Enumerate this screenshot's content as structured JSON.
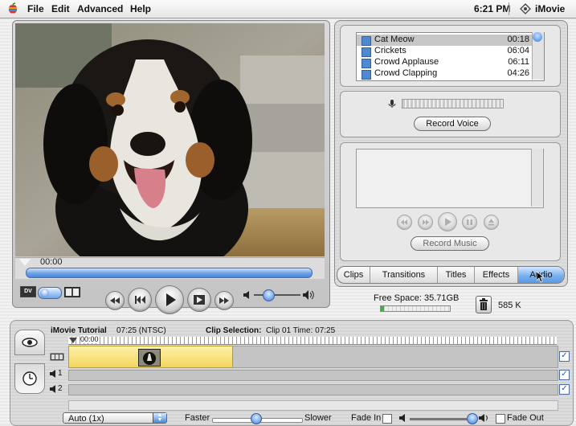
{
  "menubar": {
    "items": [
      "File",
      "Edit",
      "Advanced",
      "Help"
    ],
    "clock": "6:21 PM",
    "app": "iMovie"
  },
  "monitor": {
    "time": "00:00",
    "dv_label": "DV"
  },
  "audio": {
    "tracks": [
      {
        "name": "Cat Meow",
        "duration": "00:18",
        "selected": true
      },
      {
        "name": "Crickets",
        "duration": "06:04",
        "selected": false
      },
      {
        "name": "Crowd Applause",
        "duration": "06:11",
        "selected": false
      },
      {
        "name": "Crowd Clapping",
        "duration": "04:26",
        "selected": false
      }
    ],
    "record_voice": "Record Voice",
    "record_music": "Record Music"
  },
  "tabs": [
    {
      "label": "Clips",
      "active": false
    },
    {
      "label": "Transitions",
      "active": false
    },
    {
      "label": "Titles",
      "active": false
    },
    {
      "label": "Effects",
      "active": false
    },
    {
      "label": "Audio",
      "active": true
    }
  ],
  "status": {
    "free_space": "Free Space: 35.71GB",
    "trash_size": "585 K"
  },
  "timeline": {
    "project": "iMovie Tutorial",
    "project_duration": "07:25 (NTSC)",
    "clip_selection_label": "Clip Selection:",
    "clip_selection_value": "Clip 01  Time: 07:25",
    "ruler_start": "00:00",
    "track1": "1",
    "track2": "2",
    "speed_select": "Auto (1x)",
    "faster": "Faster",
    "slower": "Slower",
    "fade_in": "Fade In",
    "fade_out": "Fade Out"
  }
}
